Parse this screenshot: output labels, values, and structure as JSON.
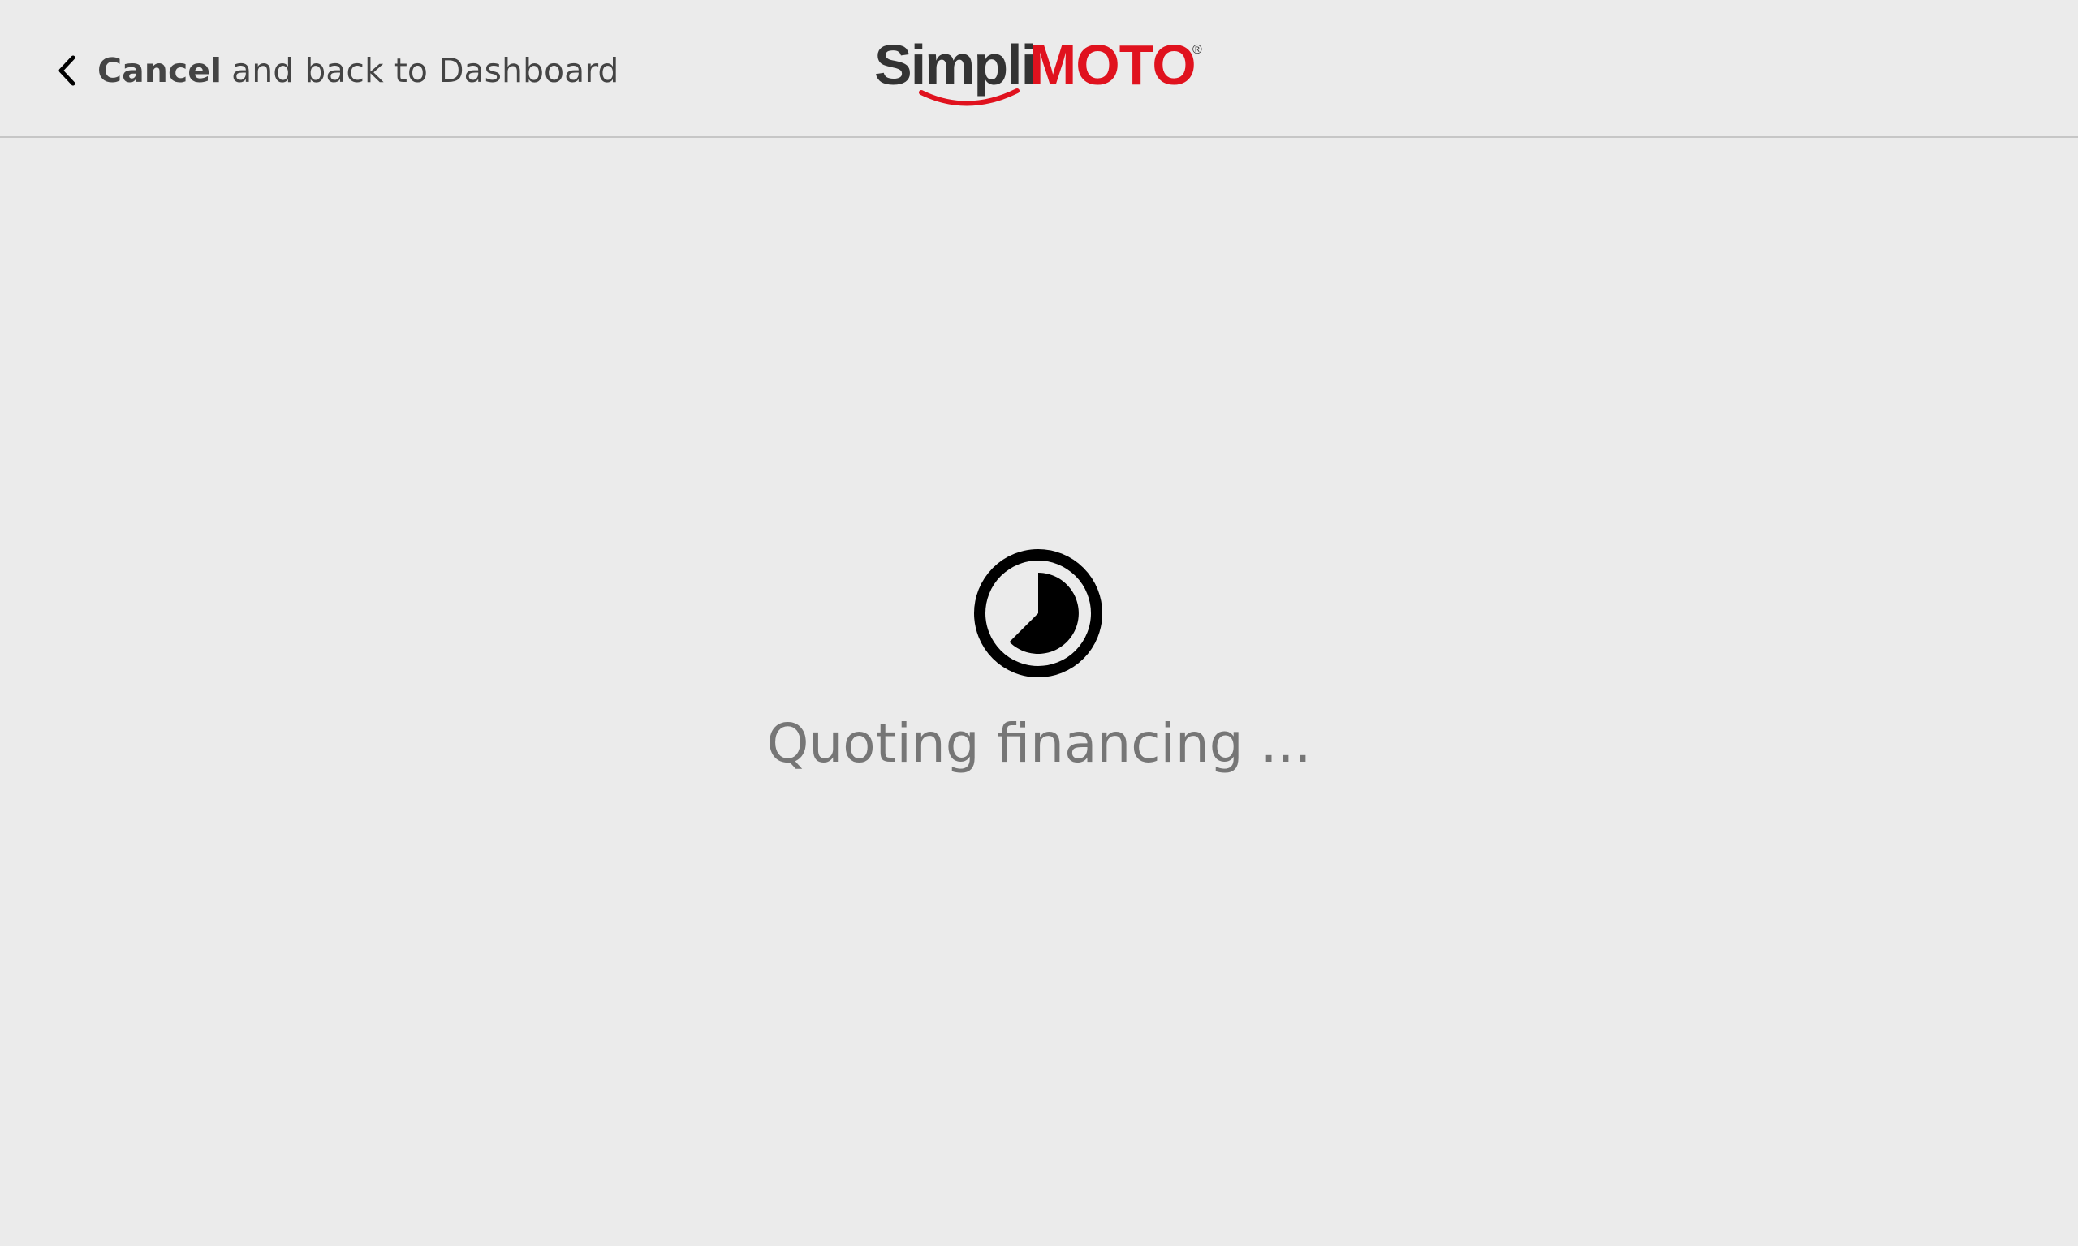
{
  "header": {
    "back_bold": "Cancel",
    "back_rest": "and back to Dashboard",
    "logo_text_part1": "Simpli",
    "logo_text_part2": "MOTO",
    "logo_mark": "®"
  },
  "main": {
    "status_text": "Quoting financing ...",
    "loader_icon": "timer-pie-icon"
  },
  "colors": {
    "background": "#ebebeb",
    "brand_red": "#e0121e",
    "logo_dark": "#333333",
    "text_muted": "#767676",
    "text_dark": "#444444"
  }
}
